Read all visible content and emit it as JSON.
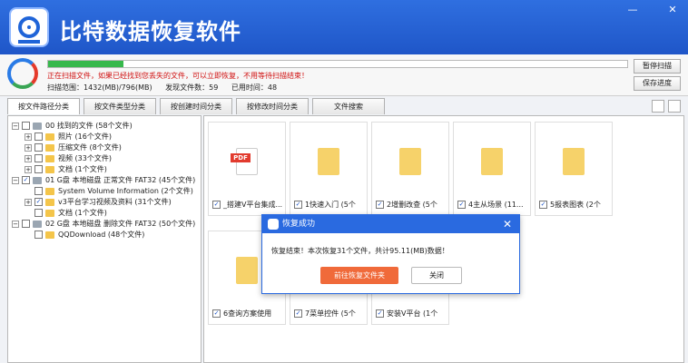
{
  "app": {
    "title": "比特数据恢复软件"
  },
  "window": {
    "minimize": "—",
    "close": "✕"
  },
  "scan": {
    "progress": 0.13,
    "warning": "正在扫描文件，如果已经找到您丢失的文件，可以立即恢复，不用等待扫描结束！",
    "range_label": "扫描范围：1432(MB)/796(MB)",
    "found_label": "发现文件数：59",
    "time_label": "已用时间：48",
    "pause_button": "暂停扫描",
    "save_button": "保存进度"
  },
  "tabs": [
    {
      "label": "按文件路径分类"
    },
    {
      "label": "按文件类型分类"
    },
    {
      "label": "按创建时间分类"
    },
    {
      "label": "按修改时间分类"
    },
    {
      "label": "文件搜索"
    }
  ],
  "tree": [
    {
      "label": "00 找到的文件 (58个文件)"
    },
    {
      "label": "照片 (16个文件)"
    },
    {
      "label": "压缩文件 (8个文件)"
    },
    {
      "label": "视频 (33个文件)"
    },
    {
      "label": "文档 (1个文件)"
    },
    {
      "label": "01 G盘 本地磁盘 正常文件 FAT32 (45个文件)"
    },
    {
      "label": "System Volume Information (2个文件)"
    },
    {
      "label": "v3平台学习视频及资料 (31个文件)"
    },
    {
      "label": "文档 (1个文件)"
    },
    {
      "label": "02 G盘 本地磁盘 删除文件 FAT32 (50个文件)"
    },
    {
      "label": "QQDownload (48个文件)"
    }
  ],
  "files": [
    {
      "name": "_搭建V平台集成...",
      "type": "pdf"
    },
    {
      "name": "1快速入门 (5个",
      "type": "folder"
    },
    {
      "name": "2增删改查 (5个",
      "type": "folder"
    },
    {
      "name": "4主从场景 (11...",
      "type": "folder"
    },
    {
      "name": "5报表图表 (2个",
      "type": "folder"
    },
    {
      "name": "6查询方案使用",
      "type": "folder"
    },
    {
      "name": "7菜单控件 (5个",
      "type": "folder"
    },
    {
      "name": "安装V平台 (1个",
      "type": "folder"
    }
  ],
  "pdf_label": "PDF",
  "dialog": {
    "title": "恢复成功",
    "message": "恢复结束！本次恢复31个文件，共计95.11(MB)数据！",
    "open_button": "前往恢复文件夹",
    "close_button": "关闭",
    "close_icon": "✕"
  },
  "colors": {
    "brand": "#1f56c8",
    "warning": "#d01010",
    "primary_button": "#f06a3a",
    "progress": "#37b84c"
  }
}
